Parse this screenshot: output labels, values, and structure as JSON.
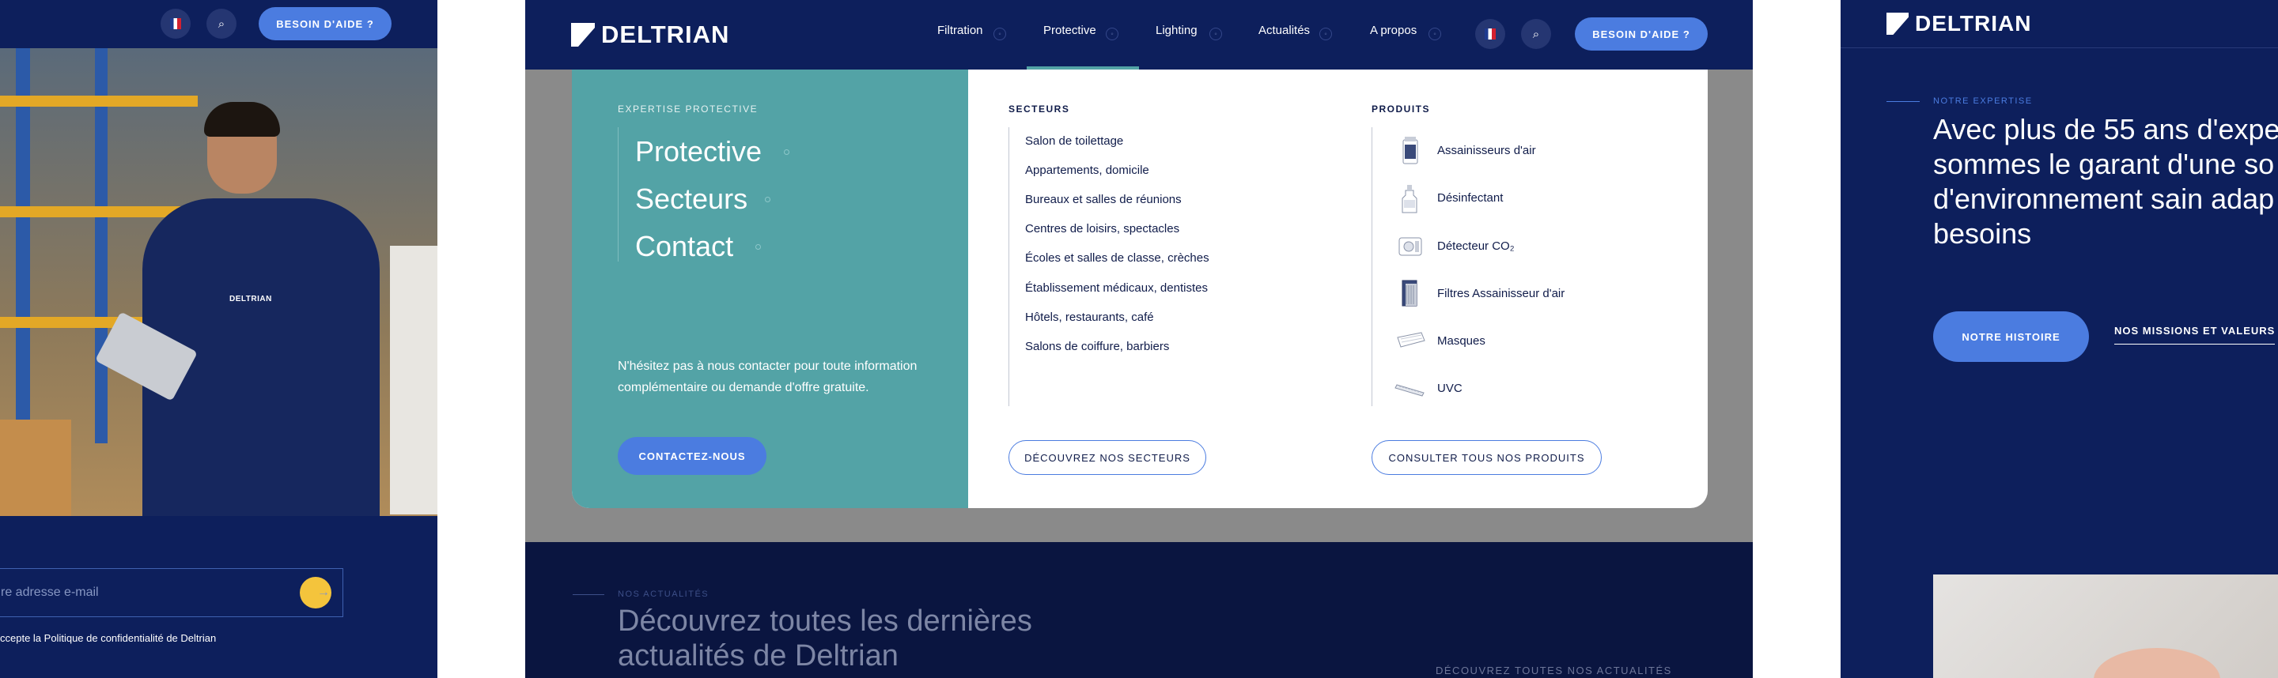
{
  "left": {
    "help_label": "BESOIN D'AIDE ?",
    "shirt_logo": "DELTRIAN",
    "email_placeholder": "re adresse e-mail",
    "privacy_prefix": "ccepte la ",
    "privacy_link": "Politique de confidentialité de Deltrian"
  },
  "center": {
    "logo": "DELTRIAN",
    "nav": [
      {
        "label": "Filtration"
      },
      {
        "label": "Protective"
      },
      {
        "label": "Lighting"
      },
      {
        "label": "Actualités"
      },
      {
        "label": "A propos"
      }
    ],
    "help_label": "BESOIN D'AIDE ?",
    "mega": {
      "eyebrow": "EXPERTISE PROTECTIVE",
      "links": [
        "Protective",
        "Secteurs",
        "Contact"
      ],
      "message": "N'hésitez pas à nous contacter pour toute information complémentaire ou demande d'offre gratuite.",
      "cta": "CONTACTEZ-NOUS",
      "sectors_title": "SECTEURS",
      "sectors": [
        "Salon de toilettage",
        "Appartements, domicile",
        "Bureaux et salles de réunions",
        "Centres de loisirs, spectacles",
        "Écoles et salles de classe, crèches",
        "Établissement médicaux, dentistes",
        "Hôtels, restaurants, café",
        "Salons de coiffure, barbiers"
      ],
      "sectors_button": "DÉCOUVREZ NOS SECTEURS",
      "products_title": "PRODUITS",
      "products": [
        "Assainisseurs d'air",
        "Désinfectant",
        "Détecteur CO₂",
        "Filtres Assainisseur d'air",
        "Masques",
        "UVC"
      ],
      "products_button": "CONSULTER TOUS NOS PRODUITS"
    },
    "news": {
      "eyebrow": "NOS ACTUALITÉS",
      "title": "Découvrez toutes les dernières actualités de Deltrian",
      "all_link": "DÉCOUVREZ TOUTES NOS ACTUALITÉS"
    }
  },
  "right": {
    "logo": "DELTRIAN",
    "eyebrow": "NOTRE EXPERTISE",
    "headline": "Avec plus de 55 ans d'expe sommes le garant d'une so d'environnement sain adap besoins",
    "button_primary": "NOTRE HISTOIRE",
    "button_secondary": "NOS MISSIONS ET VALEURS"
  },
  "colors": {
    "navy": "#0d1f5c",
    "accent_blue": "#4b7ce0",
    "teal": "#53a3a6",
    "yellow": "#f4c43c"
  },
  "icons": [
    "flag-fr-icon",
    "search-icon",
    "arrow-right-icon",
    "deltrian-logo-icon",
    "chevron-down-icon"
  ]
}
